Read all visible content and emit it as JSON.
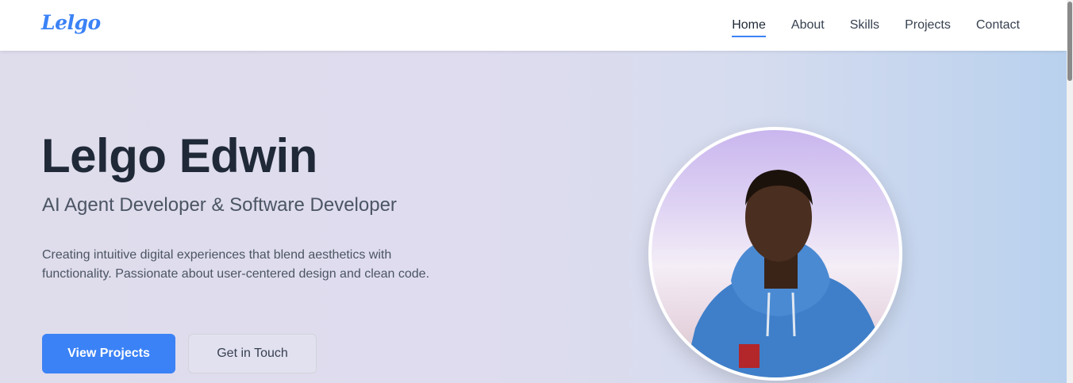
{
  "brand": {
    "logo_text": "Lelgo",
    "accent": "#3b82f6"
  },
  "nav": {
    "items": [
      {
        "label": "Home",
        "active": true
      },
      {
        "label": "About",
        "active": false
      },
      {
        "label": "Skills",
        "active": false
      },
      {
        "label": "Projects",
        "active": false
      },
      {
        "label": "Contact",
        "active": false
      }
    ]
  },
  "hero": {
    "name": "Lelgo Edwin",
    "subtitle": "AI Agent Developer & Software Developer",
    "description": "Creating intuitive digital experiences that blend aesthetics with functionality. Passionate about user-centered design and clean code.",
    "primary_button": "View Projects",
    "secondary_button": "Get in Touch"
  }
}
